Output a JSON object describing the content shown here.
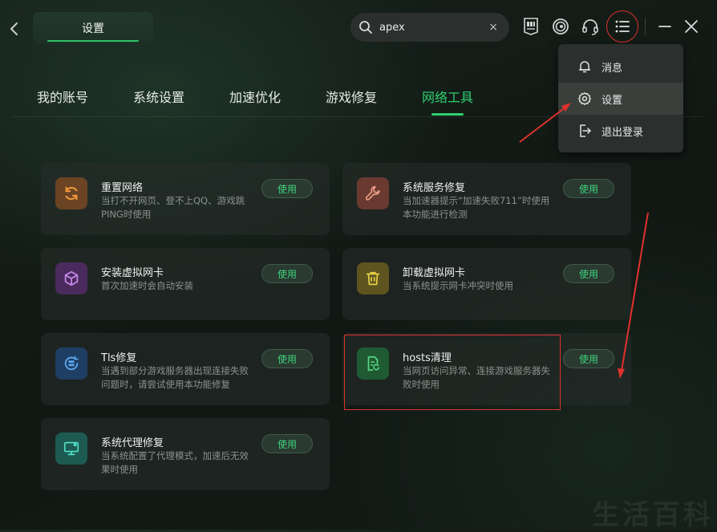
{
  "header": {
    "active_tab": "设置",
    "search": {
      "value": "apex",
      "clear_label": "×"
    }
  },
  "nav": {
    "tabs": [
      {
        "label": "我的账号"
      },
      {
        "label": "系统设置"
      },
      {
        "label": "加速优化"
      },
      {
        "label": "游戏修复"
      },
      {
        "label": "网络工具",
        "active": true
      }
    ]
  },
  "cards": [
    {
      "title": "重置网络",
      "desc": "当打不开网页、登不上QQ、游戏跳PING时使用",
      "button": "使用",
      "icon": "refresh-icon",
      "tile_color": "#6b4424"
    },
    {
      "title": "系统服务修复",
      "desc": "当加速器提示“加速失败711”时使用本功能进行检测",
      "button": "使用",
      "icon": "wrench-icon",
      "tile_color": "#6a3a30"
    },
    {
      "title": "安装虚拟网卡",
      "desc": "首次加速时会自动安装",
      "button": "使用",
      "icon": "cube-icon",
      "tile_color": "#4b2a5e"
    },
    {
      "title": "卸载虚拟网卡",
      "desc": "当系统提示网卡冲突时使用",
      "button": "使用",
      "icon": "trash-icon",
      "tile_color": "#5e5420"
    },
    {
      "title": "Tls修复",
      "desc": "当遇到部分游戏服务器出现连接失败问题时，请尝试使用本功能修复",
      "button": "使用",
      "icon": "server-icon",
      "tile_color": "#1f3e63"
    },
    {
      "title": "hosts清理",
      "desc": "当网页访问异常、连接游戏服务器失败时使用",
      "button": "使用",
      "icon": "file-refresh-icon",
      "tile_color": "#1f5a33"
    },
    {
      "title": "系统代理修复",
      "desc": "当系统配置了代理模式，加速后无效果时使用",
      "button": "使用",
      "icon": "monitor-icon",
      "tile_color": "#1c5a52"
    }
  ],
  "dropdown": {
    "items": [
      {
        "label": "消息",
        "icon": "bell-icon"
      },
      {
        "label": "设置",
        "icon": "gear-icon",
        "highlighted": true
      },
      {
        "label": "退出登录",
        "icon": "logout-icon"
      }
    ]
  },
  "watermark": "生活百科",
  "colors": {
    "accent": "#2fd070",
    "annotation": "#e0322c"
  }
}
